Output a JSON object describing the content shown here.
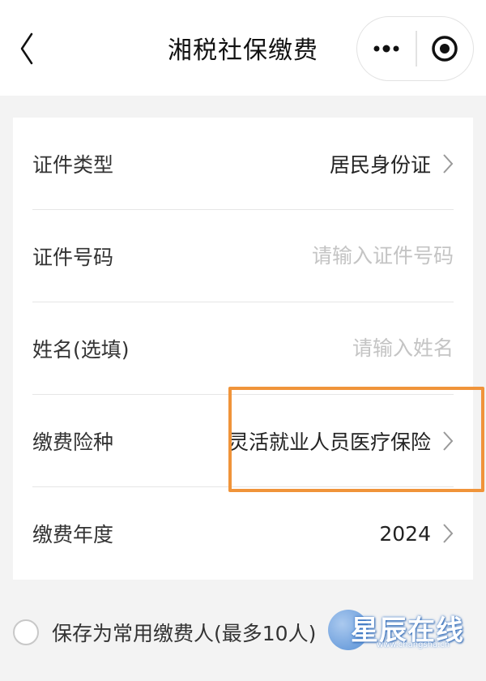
{
  "navbar": {
    "title": "湘税社保缴费",
    "back_icon": "chevron-left-icon",
    "more_icon": "more-dots-icon",
    "close_icon": "target-circle-icon"
  },
  "form": {
    "id_type": {
      "label": "证件类型",
      "value": "居民身份证"
    },
    "id_number": {
      "label": "证件号码",
      "value": "",
      "placeholder": "请输入证件号码"
    },
    "name": {
      "label": "姓名(选填)",
      "value": "",
      "placeholder": "请输入姓名"
    },
    "insurance_type": {
      "label": "缴费险种",
      "value": "灵活就业人员医疗保险"
    },
    "year": {
      "label": "缴费年度",
      "value": "2024"
    }
  },
  "save_option": {
    "label": "保存为常用缴费人(最多10人)",
    "checked": false
  },
  "watermark": {
    "text": "星辰在线",
    "url": "www.changsha.cn"
  },
  "colors": {
    "highlight": "#f0943a",
    "background": "#f3f3f3",
    "placeholder": "#c4c4c4"
  }
}
